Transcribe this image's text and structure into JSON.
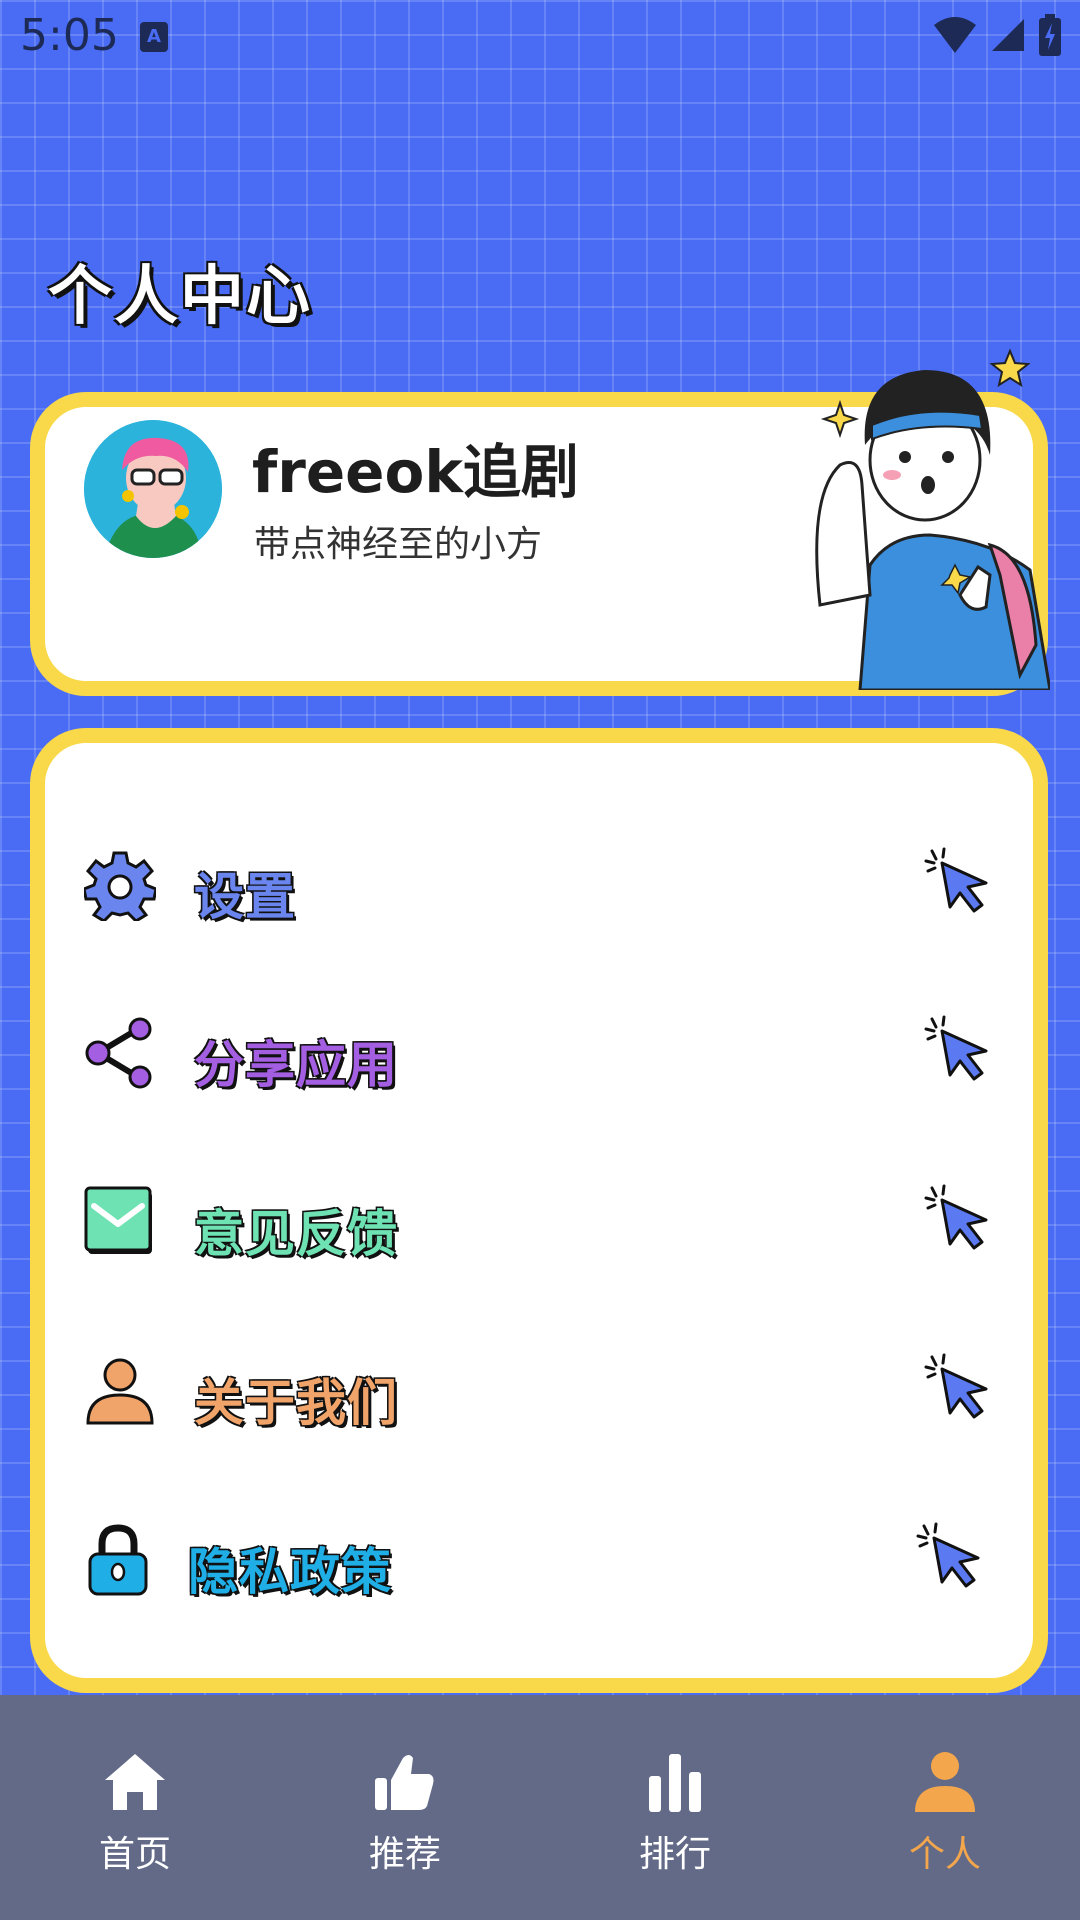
{
  "status_bar": {
    "time": "5:05",
    "notification_icon": "a-icon",
    "icons": [
      "wifi-icon",
      "signal-icon",
      "battery-charging-icon"
    ]
  },
  "page": {
    "title": "个人中心"
  },
  "profile": {
    "name": "freeok追剧",
    "bio": "带点神经至的小方",
    "avatar_icon": "avatar-illustration",
    "mascot": "mascot-illustration"
  },
  "menu": {
    "items": [
      {
        "label": "设置",
        "icon": "gear-icon",
        "color": "#6a86ee"
      },
      {
        "label": "分享应用",
        "icon": "share-icon",
        "color": "#a45ee2"
      },
      {
        "label": "意见反馈",
        "icon": "mail-icon",
        "color": "#6fe2b3"
      },
      {
        "label": "关于我们",
        "icon": "person-icon",
        "color": "#f0a46a"
      },
      {
        "label": "隐私政策",
        "icon": "lock-icon",
        "color": "#1faee6"
      }
    ],
    "arrow_icon": "cursor-click-icon"
  },
  "nav": {
    "items": [
      {
        "label": "首页",
        "icon": "home-icon"
      },
      {
        "label": "推荐",
        "icon": "thumbs-up-icon"
      },
      {
        "label": "排行",
        "icon": "bar-chart-icon"
      },
      {
        "label": "个人",
        "icon": "person-icon",
        "active": true
      }
    ]
  },
  "colors": {
    "background": "#4a6cf5",
    "card_border": "#f9d84a",
    "nav_background": "#626a87",
    "nav_active": "#f3a64b"
  }
}
